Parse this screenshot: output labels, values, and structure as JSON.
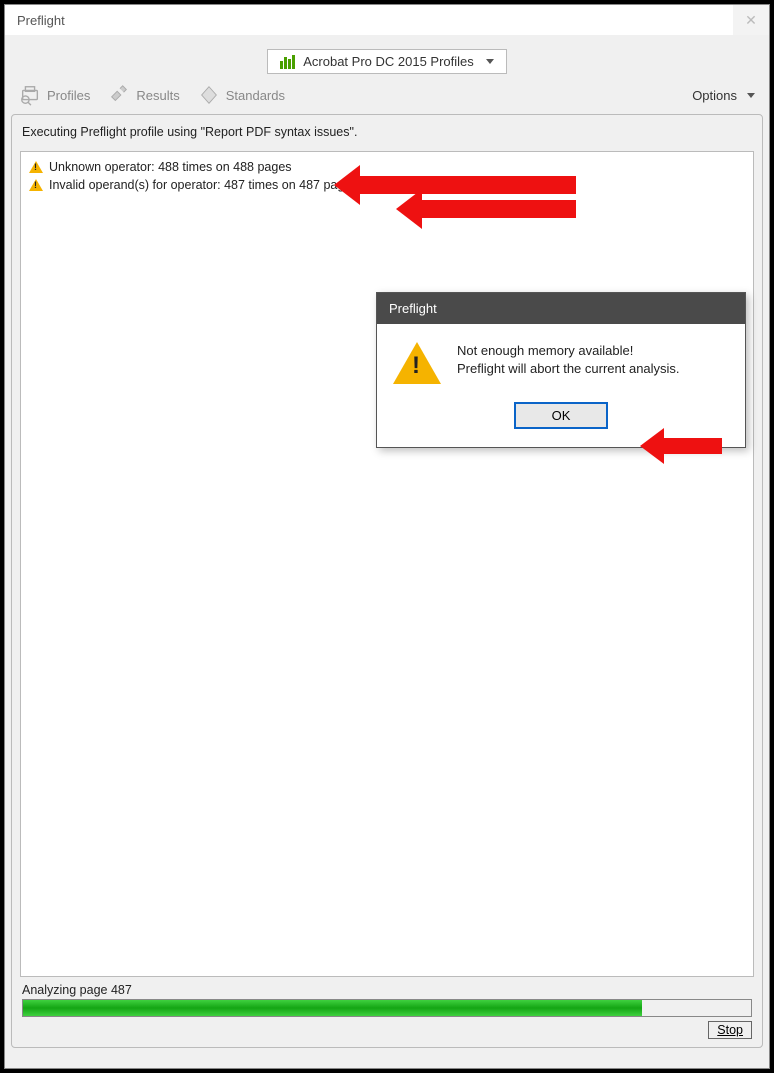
{
  "window": {
    "title": "Preflight"
  },
  "profileSelector": {
    "label": "Acrobat Pro DC 2015 Profiles"
  },
  "toolbar": {
    "profiles": "Profiles",
    "results": "Results",
    "standards": "Standards",
    "options": "Options"
  },
  "statusLine": "Executing Preflight profile using \"Report PDF syntax issues\".",
  "results": [
    {
      "text": "Unknown operator: 488 times on 488 pages"
    },
    {
      "text": "Invalid operand(s) for operator: 487 times on 487 pages"
    }
  ],
  "dialog": {
    "title": "Preflight",
    "line1": "Not enough memory available!",
    "line2": "Preflight will abort the current analysis.",
    "ok": "OK"
  },
  "footer": {
    "analyzing": "Analyzing page 487",
    "stop": "Stop"
  }
}
